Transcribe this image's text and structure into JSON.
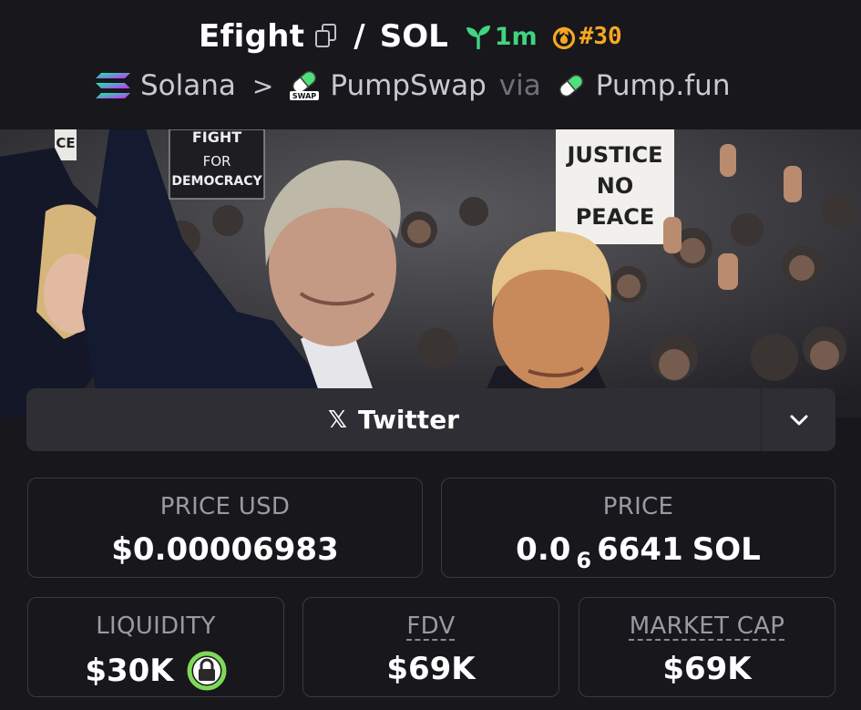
{
  "header": {
    "token_symbol": "Efight",
    "separator": "/",
    "quote_symbol": "SOL",
    "age": "1m",
    "rank": "#30",
    "breadcrumb": {
      "chain": "Solana",
      "arrow": ">",
      "dex": "PumpSwap",
      "via": "via",
      "launchpad": "Pump.fun"
    }
  },
  "banner": {
    "signs": [
      "FIGHT FOR DEMOCRACY",
      "NO JUSTICE NO PEACE",
      "CE"
    ]
  },
  "social": {
    "x_glyph": "𝕏",
    "label": "Twitter"
  },
  "stats": {
    "price_usd": {
      "label": "PRICE USD",
      "value": "$0.00006983"
    },
    "price": {
      "label": "PRICE",
      "prefix": "0.0",
      "zeros": "6",
      "digits": "6641",
      "unit": "SOL"
    },
    "liquidity": {
      "label": "LIQUIDITY",
      "value": "$30K"
    },
    "fdv": {
      "label": "FDV",
      "value": "$69K"
    },
    "market_cap": {
      "label": "MARKET CAP",
      "value": "$69K"
    }
  },
  "colors": {
    "background": "#17171c",
    "age_green": "#41d480",
    "rank_orange": "#f5a623",
    "card_border": "#3a3a41",
    "lock_green": "#7ed957"
  },
  "icons": {
    "copy": "copy-icon",
    "seedling": "seedling-icon",
    "flame": "flame-icon",
    "solana": "solana-logo-icon",
    "pill": "pill-icon",
    "chevron": "chevron-down-icon",
    "lock": "lock-icon"
  }
}
